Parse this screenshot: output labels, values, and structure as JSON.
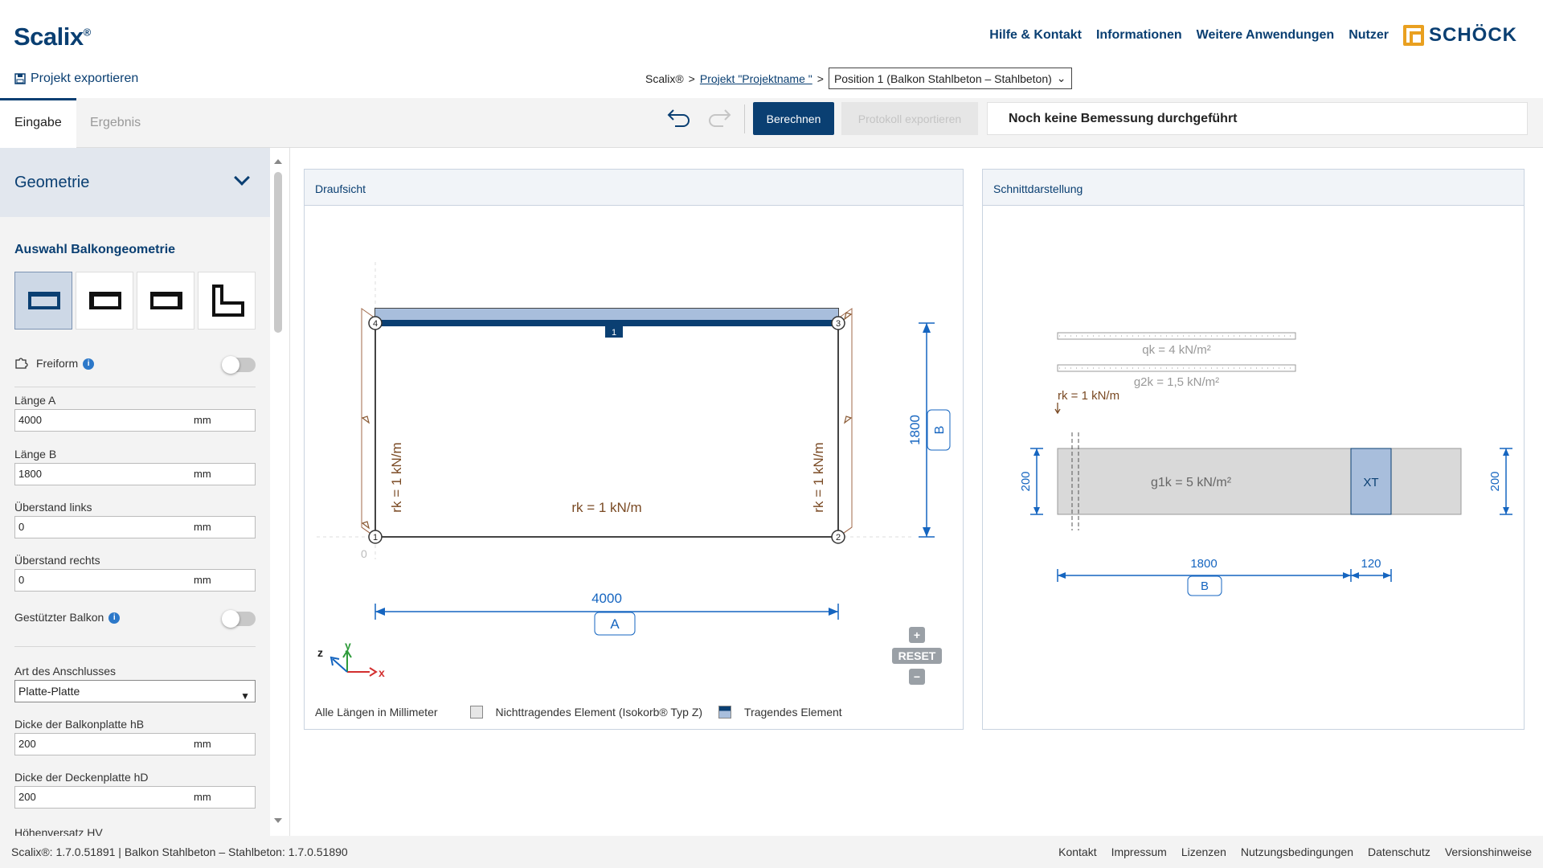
{
  "app": {
    "name": "Scalix",
    "reg": "®"
  },
  "nav": {
    "help": "Hilfe & Kontakt",
    "info": "Informationen",
    "apps": "Weitere Anwendungen",
    "user": "Nutzer",
    "brand": "SCHÖCK"
  },
  "export_label": "Projekt exportieren",
  "breadcrumb": {
    "root": "Scalix®",
    "sep": ">",
    "project": "Projekt \"Projektname \"",
    "position": "Position 1 (Balkon Stahlbeton – Stahlbeton)"
  },
  "tabs": {
    "input": "Eingabe",
    "result": "Ergebnis"
  },
  "toolbar": {
    "calculate": "Berechnen",
    "protocol": "Protokoll exportieren",
    "status": "Noch keine Bemessung durchgeführt"
  },
  "sidebar": {
    "section": "Geometrie",
    "geo_title": "Auswahl Balkongeometrie",
    "freeform": "Freiform",
    "length_a": {
      "label": "Länge A",
      "value": "4000",
      "unit": "mm"
    },
    "length_b": {
      "label": "Länge B",
      "value": "1800",
      "unit": "mm"
    },
    "overhang_left": {
      "label": "Überstand links",
      "value": "0",
      "unit": "mm"
    },
    "overhang_right": {
      "label": "Überstand rechts",
      "value": "0",
      "unit": "mm"
    },
    "supported": "Gestützter Balkon",
    "connection": {
      "label": "Art des Anschlusses",
      "value": "Platte-Platte"
    },
    "hb": {
      "label": "Dicke der Balkonplatte hB",
      "value": "200",
      "unit": "mm"
    },
    "hd": {
      "label": "Dicke der Deckenplatte hD",
      "value": "200",
      "unit": "mm"
    },
    "hv": {
      "label": "Höhenversatz HV"
    }
  },
  "plan": {
    "title": "Draufsicht",
    "load_left": "rk = 1 kN/m",
    "load_right": "rk = 1 kN/m",
    "load_bottom": "rk = 1 kN/m",
    "dim_a": "4000",
    "dim_a_label": "A",
    "dim_b": "1800",
    "dim_b_label": "B",
    "node1": "1",
    "node2": "2",
    "node3": "3",
    "node4": "4",
    "edge": "1",
    "origin": "0",
    "ax_x": "x",
    "ax_y": "y",
    "ax_z": "z",
    "legend_units": "Alle Längen in Millimeter",
    "legend_nonbearing": "Nichttragendes Element (Isokorb® Typ Z)",
    "legend_bearing": "Tragendes Element",
    "reset": "RESET"
  },
  "section": {
    "title": "Schnittdarstellung",
    "qk": "qk = 4 kN/m²",
    "g2k": "g2k = 1,5 kN/m²",
    "rk": "rk = 1 kN/m",
    "g1k": "g1k = 5 kN/m²",
    "xt": "XT",
    "h_left": "200",
    "h_right": "200",
    "dim_b": "1800",
    "dim_b_label": "B",
    "dim_xt": "120"
  },
  "footer": {
    "version": "Scalix®: 1.7.0.51891 | Balkon Stahlbeton – Stahlbeton: 1.7.0.51890",
    "links": [
      "Kontakt",
      "Impressum",
      "Lizenzen",
      "Nutzungsbedingungen",
      "Datenschutz",
      "Versionshinweise"
    ]
  },
  "colors": {
    "primary": "#0a3f72",
    "blue": "#1565c0",
    "load": "#7a4a24"
  }
}
